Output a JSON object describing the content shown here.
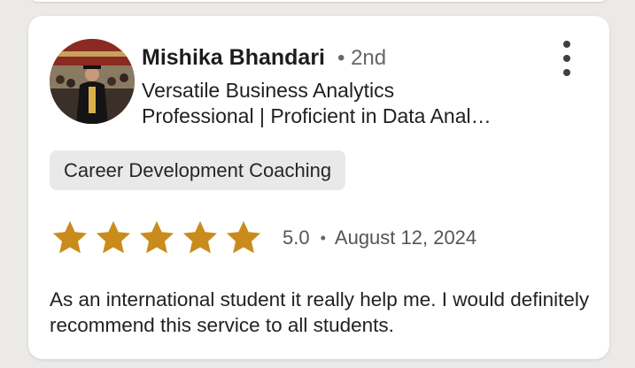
{
  "review": {
    "reviewer_name": "Mishika Bhandari",
    "connection_degree": "• 2nd",
    "headline_line1": "Versatile Business Analytics",
    "headline_line2": "Professional | Proficient in Data Anal…",
    "service_chip": "Career Development Coaching",
    "rating_value": "5.0",
    "rating_stars": 5,
    "separator": "•",
    "date": "August 12, 2024",
    "text": "As an international student it really help me. I would definitely recommend this service to all students."
  },
  "colors": {
    "star": "#c98c1c",
    "card": "#ffffff",
    "background": "#ebeae8",
    "chip": "#e9e9e9"
  },
  "icons": {
    "menu": "more-vertical-icon",
    "star": "star-icon"
  }
}
